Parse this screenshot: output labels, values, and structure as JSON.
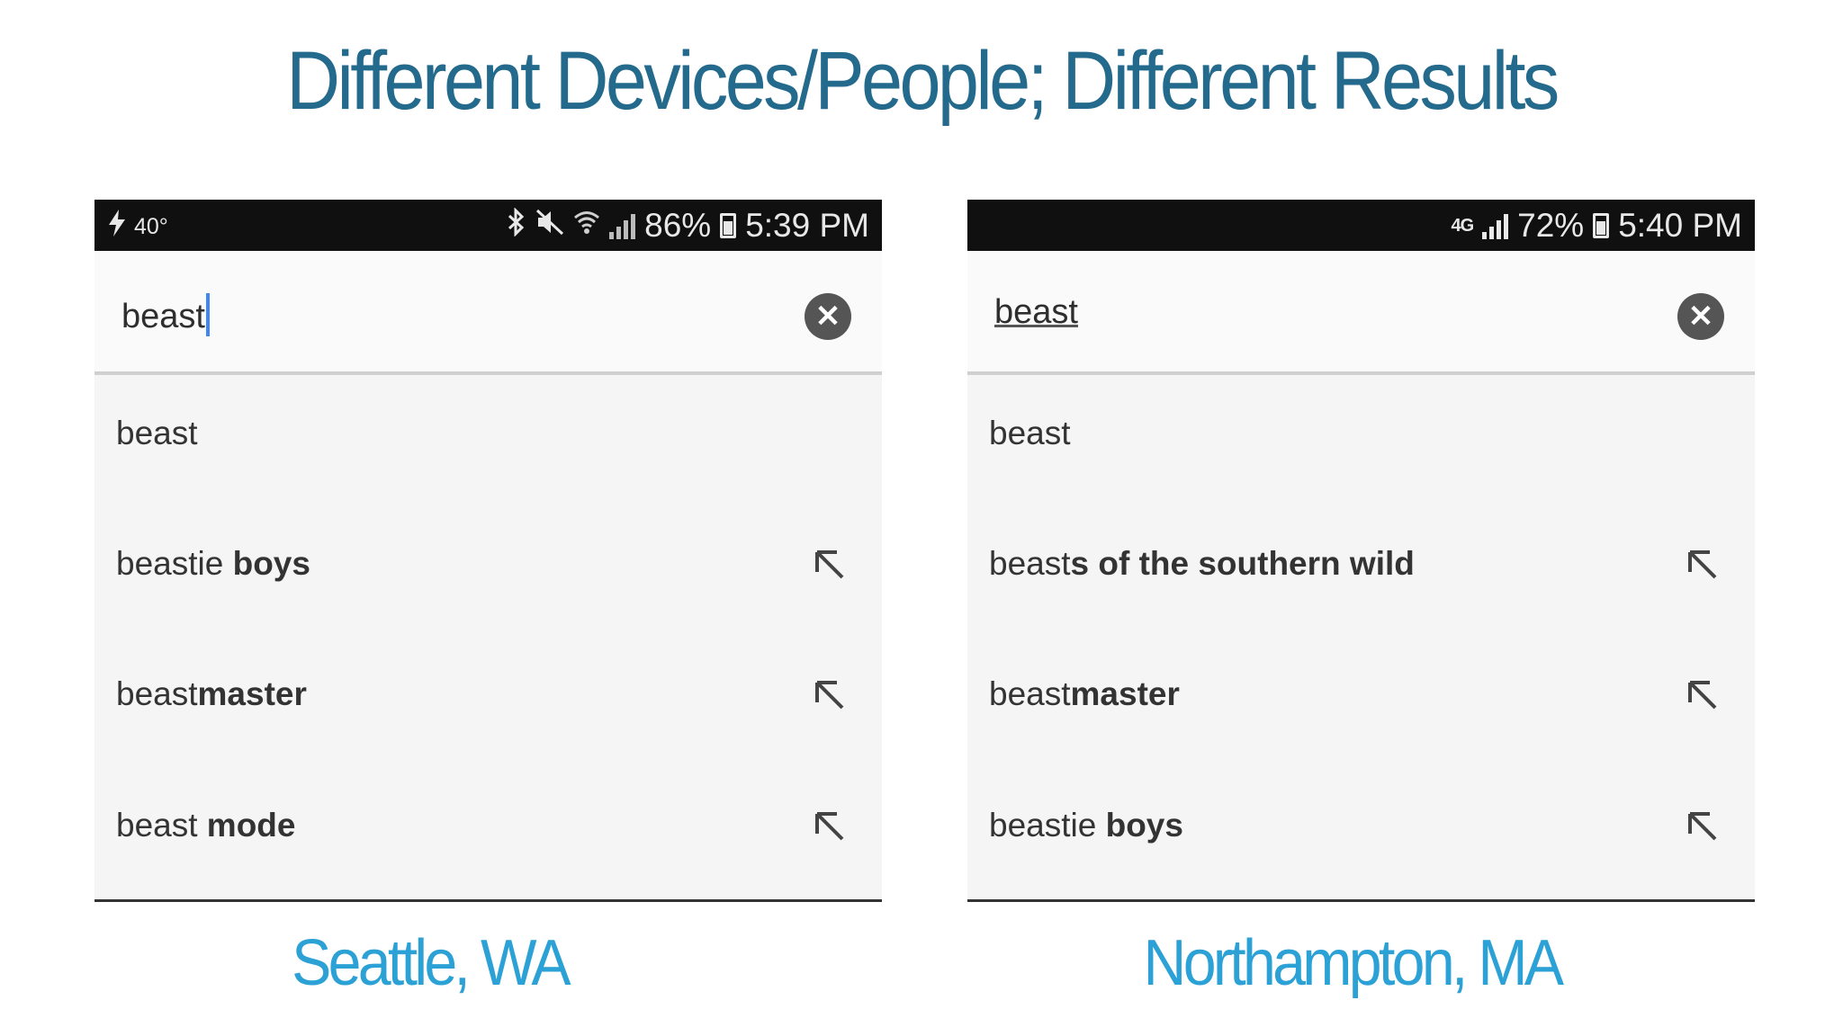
{
  "slide": {
    "title": "Different Devices/People; Different Results"
  },
  "phones": [
    {
      "status_bar": {
        "left_icons": [
          "lightning-icon"
        ],
        "temperature": "40°",
        "right_icons": [
          "bluetooth-icon",
          "mute-icon",
          "wifi-icon",
          "signal-icon",
          "battery-icon"
        ],
        "battery_percent": "86%",
        "time": "5:39 PM"
      },
      "search": {
        "query": "beast",
        "cursor_visible": true,
        "clear_icon": "close-icon"
      },
      "suggestions": [
        {
          "prefix": "beast",
          "suffix": "",
          "has_arrow": false
        },
        {
          "prefix": "beastie",
          "suffix": " boys",
          "has_arrow": true
        },
        {
          "prefix": "beast",
          "suffix": "master",
          "has_arrow": true
        },
        {
          "prefix": "beast",
          "suffix": " mode",
          "has_arrow": true
        }
      ],
      "location": "Seattle, WA"
    },
    {
      "status_bar": {
        "left_icons": [],
        "temperature": "",
        "network": "4G",
        "right_icons": [
          "lte-icon",
          "signal-icon",
          "battery-icon"
        ],
        "battery_percent": "72%",
        "time": "5:40 PM"
      },
      "search": {
        "query": "beast",
        "cursor_visible": false,
        "clear_icon": "close-icon"
      },
      "suggestions": [
        {
          "prefix": "beast",
          "suffix": "",
          "has_arrow": false
        },
        {
          "prefix": "beast",
          "suffix": "s of the southern wild",
          "has_arrow": true
        },
        {
          "prefix": "beast",
          "suffix": "master",
          "has_arrow": true
        },
        {
          "prefix": "beastie",
          "suffix": " boys",
          "has_arrow": true
        }
      ],
      "location": "Northampton, MA"
    }
  ],
  "colors": {
    "title": "#246a8c",
    "location": "#2ca1d6",
    "status_bar": "#101010",
    "cursor": "#4285f4"
  }
}
